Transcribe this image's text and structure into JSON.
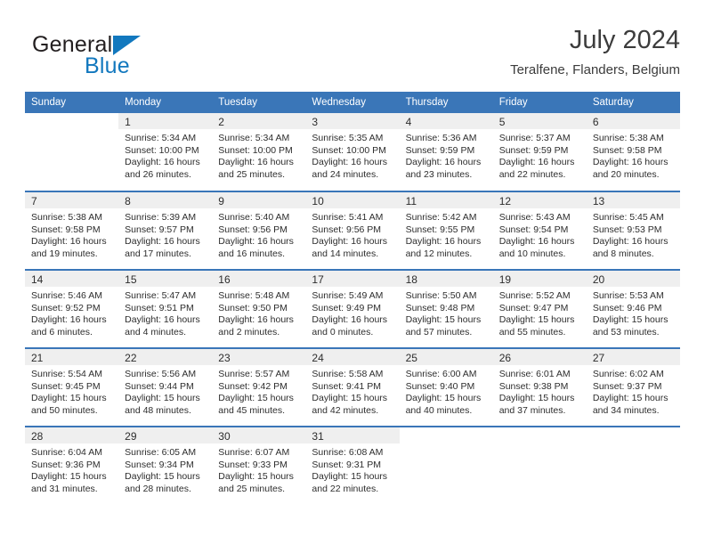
{
  "brand": {
    "name_top": "General",
    "name_bottom": "Blue",
    "triangle_color": "#1278be",
    "top_color": "#231f20",
    "bottom_color": "#1278be"
  },
  "header": {
    "title": "July 2024",
    "subtitle": "Teralfene, Flanders, Belgium"
  },
  "colors": {
    "header_blue": "#3a76b8",
    "daynum_band": "#efefef",
    "text": "#2d2d2d"
  },
  "weekday_headers": [
    "Sunday",
    "Monday",
    "Tuesday",
    "Wednesday",
    "Thursday",
    "Friday",
    "Saturday"
  ],
  "weeks": [
    [
      {
        "day": "",
        "sunrise": "",
        "sunset": "",
        "daylight_line1": "",
        "daylight_line2": ""
      },
      {
        "day": "1",
        "sunrise": "Sunrise: 5:34 AM",
        "sunset": "Sunset: 10:00 PM",
        "daylight_line1": "Daylight: 16 hours",
        "daylight_line2": "and 26 minutes."
      },
      {
        "day": "2",
        "sunrise": "Sunrise: 5:34 AM",
        "sunset": "Sunset: 10:00 PM",
        "daylight_line1": "Daylight: 16 hours",
        "daylight_line2": "and 25 minutes."
      },
      {
        "day": "3",
        "sunrise": "Sunrise: 5:35 AM",
        "sunset": "Sunset: 10:00 PM",
        "daylight_line1": "Daylight: 16 hours",
        "daylight_line2": "and 24 minutes."
      },
      {
        "day": "4",
        "sunrise": "Sunrise: 5:36 AM",
        "sunset": "Sunset: 9:59 PM",
        "daylight_line1": "Daylight: 16 hours",
        "daylight_line2": "and 23 minutes."
      },
      {
        "day": "5",
        "sunrise": "Sunrise: 5:37 AM",
        "sunset": "Sunset: 9:59 PM",
        "daylight_line1": "Daylight: 16 hours",
        "daylight_line2": "and 22 minutes."
      },
      {
        "day": "6",
        "sunrise": "Sunrise: 5:38 AM",
        "sunset": "Sunset: 9:58 PM",
        "daylight_line1": "Daylight: 16 hours",
        "daylight_line2": "and 20 minutes."
      }
    ],
    [
      {
        "day": "7",
        "sunrise": "Sunrise: 5:38 AM",
        "sunset": "Sunset: 9:58 PM",
        "daylight_line1": "Daylight: 16 hours",
        "daylight_line2": "and 19 minutes."
      },
      {
        "day": "8",
        "sunrise": "Sunrise: 5:39 AM",
        "sunset": "Sunset: 9:57 PM",
        "daylight_line1": "Daylight: 16 hours",
        "daylight_line2": "and 17 minutes."
      },
      {
        "day": "9",
        "sunrise": "Sunrise: 5:40 AM",
        "sunset": "Sunset: 9:56 PM",
        "daylight_line1": "Daylight: 16 hours",
        "daylight_line2": "and 16 minutes."
      },
      {
        "day": "10",
        "sunrise": "Sunrise: 5:41 AM",
        "sunset": "Sunset: 9:56 PM",
        "daylight_line1": "Daylight: 16 hours",
        "daylight_line2": "and 14 minutes."
      },
      {
        "day": "11",
        "sunrise": "Sunrise: 5:42 AM",
        "sunset": "Sunset: 9:55 PM",
        "daylight_line1": "Daylight: 16 hours",
        "daylight_line2": "and 12 minutes."
      },
      {
        "day": "12",
        "sunrise": "Sunrise: 5:43 AM",
        "sunset": "Sunset: 9:54 PM",
        "daylight_line1": "Daylight: 16 hours",
        "daylight_line2": "and 10 minutes."
      },
      {
        "day": "13",
        "sunrise": "Sunrise: 5:45 AM",
        "sunset": "Sunset: 9:53 PM",
        "daylight_line1": "Daylight: 16 hours",
        "daylight_line2": "and 8 minutes."
      }
    ],
    [
      {
        "day": "14",
        "sunrise": "Sunrise: 5:46 AM",
        "sunset": "Sunset: 9:52 PM",
        "daylight_line1": "Daylight: 16 hours",
        "daylight_line2": "and 6 minutes."
      },
      {
        "day": "15",
        "sunrise": "Sunrise: 5:47 AM",
        "sunset": "Sunset: 9:51 PM",
        "daylight_line1": "Daylight: 16 hours",
        "daylight_line2": "and 4 minutes."
      },
      {
        "day": "16",
        "sunrise": "Sunrise: 5:48 AM",
        "sunset": "Sunset: 9:50 PM",
        "daylight_line1": "Daylight: 16 hours",
        "daylight_line2": "and 2 minutes."
      },
      {
        "day": "17",
        "sunrise": "Sunrise: 5:49 AM",
        "sunset": "Sunset: 9:49 PM",
        "daylight_line1": "Daylight: 16 hours",
        "daylight_line2": "and 0 minutes."
      },
      {
        "day": "18",
        "sunrise": "Sunrise: 5:50 AM",
        "sunset": "Sunset: 9:48 PM",
        "daylight_line1": "Daylight: 15 hours",
        "daylight_line2": "and 57 minutes."
      },
      {
        "day": "19",
        "sunrise": "Sunrise: 5:52 AM",
        "sunset": "Sunset: 9:47 PM",
        "daylight_line1": "Daylight: 15 hours",
        "daylight_line2": "and 55 minutes."
      },
      {
        "day": "20",
        "sunrise": "Sunrise: 5:53 AM",
        "sunset": "Sunset: 9:46 PM",
        "daylight_line1": "Daylight: 15 hours",
        "daylight_line2": "and 53 minutes."
      }
    ],
    [
      {
        "day": "21",
        "sunrise": "Sunrise: 5:54 AM",
        "sunset": "Sunset: 9:45 PM",
        "daylight_line1": "Daylight: 15 hours",
        "daylight_line2": "and 50 minutes."
      },
      {
        "day": "22",
        "sunrise": "Sunrise: 5:56 AM",
        "sunset": "Sunset: 9:44 PM",
        "daylight_line1": "Daylight: 15 hours",
        "daylight_line2": "and 48 minutes."
      },
      {
        "day": "23",
        "sunrise": "Sunrise: 5:57 AM",
        "sunset": "Sunset: 9:42 PM",
        "daylight_line1": "Daylight: 15 hours",
        "daylight_line2": "and 45 minutes."
      },
      {
        "day": "24",
        "sunrise": "Sunrise: 5:58 AM",
        "sunset": "Sunset: 9:41 PM",
        "daylight_line1": "Daylight: 15 hours",
        "daylight_line2": "and 42 minutes."
      },
      {
        "day": "25",
        "sunrise": "Sunrise: 6:00 AM",
        "sunset": "Sunset: 9:40 PM",
        "daylight_line1": "Daylight: 15 hours",
        "daylight_line2": "and 40 minutes."
      },
      {
        "day": "26",
        "sunrise": "Sunrise: 6:01 AM",
        "sunset": "Sunset: 9:38 PM",
        "daylight_line1": "Daylight: 15 hours",
        "daylight_line2": "and 37 minutes."
      },
      {
        "day": "27",
        "sunrise": "Sunrise: 6:02 AM",
        "sunset": "Sunset: 9:37 PM",
        "daylight_line1": "Daylight: 15 hours",
        "daylight_line2": "and 34 minutes."
      }
    ],
    [
      {
        "day": "28",
        "sunrise": "Sunrise: 6:04 AM",
        "sunset": "Sunset: 9:36 PM",
        "daylight_line1": "Daylight: 15 hours",
        "daylight_line2": "and 31 minutes."
      },
      {
        "day": "29",
        "sunrise": "Sunrise: 6:05 AM",
        "sunset": "Sunset: 9:34 PM",
        "daylight_line1": "Daylight: 15 hours",
        "daylight_line2": "and 28 minutes."
      },
      {
        "day": "30",
        "sunrise": "Sunrise: 6:07 AM",
        "sunset": "Sunset: 9:33 PM",
        "daylight_line1": "Daylight: 15 hours",
        "daylight_line2": "and 25 minutes."
      },
      {
        "day": "31",
        "sunrise": "Sunrise: 6:08 AM",
        "sunset": "Sunset: 9:31 PM",
        "daylight_line1": "Daylight: 15 hours",
        "daylight_line2": "and 22 minutes."
      },
      {
        "day": "",
        "sunrise": "",
        "sunset": "",
        "daylight_line1": "",
        "daylight_line2": ""
      },
      {
        "day": "",
        "sunrise": "",
        "sunset": "",
        "daylight_line1": "",
        "daylight_line2": ""
      },
      {
        "day": "",
        "sunrise": "",
        "sunset": "",
        "daylight_line1": "",
        "daylight_line2": ""
      }
    ]
  ]
}
